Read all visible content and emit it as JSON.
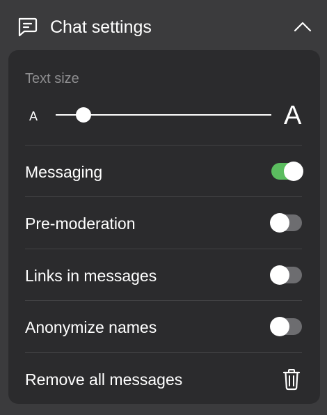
{
  "header": {
    "title": "Chat settings",
    "icon": "chat-message-icon",
    "collapse_icon": "chevron-up-icon"
  },
  "text_size": {
    "label": "Text size",
    "small_label": "A",
    "large_label": "A",
    "value_fraction": 0.13
  },
  "settings": {
    "messaging": {
      "label": "Messaging",
      "enabled": true
    },
    "pre_moderation": {
      "label": "Pre-moderation",
      "enabled": false
    },
    "links": {
      "label": "Links in messages",
      "enabled": false
    },
    "anonymize": {
      "label": "Anonymize names",
      "enabled": false
    },
    "remove_all": {
      "label": "Remove all messages",
      "icon": "trash-icon"
    }
  },
  "colors": {
    "background": "#3b3b3d",
    "panel": "#2b2b2d",
    "toggle_on": "#5bbd5f",
    "toggle_off": "#6d6d70",
    "muted_text": "#8e8e90"
  }
}
